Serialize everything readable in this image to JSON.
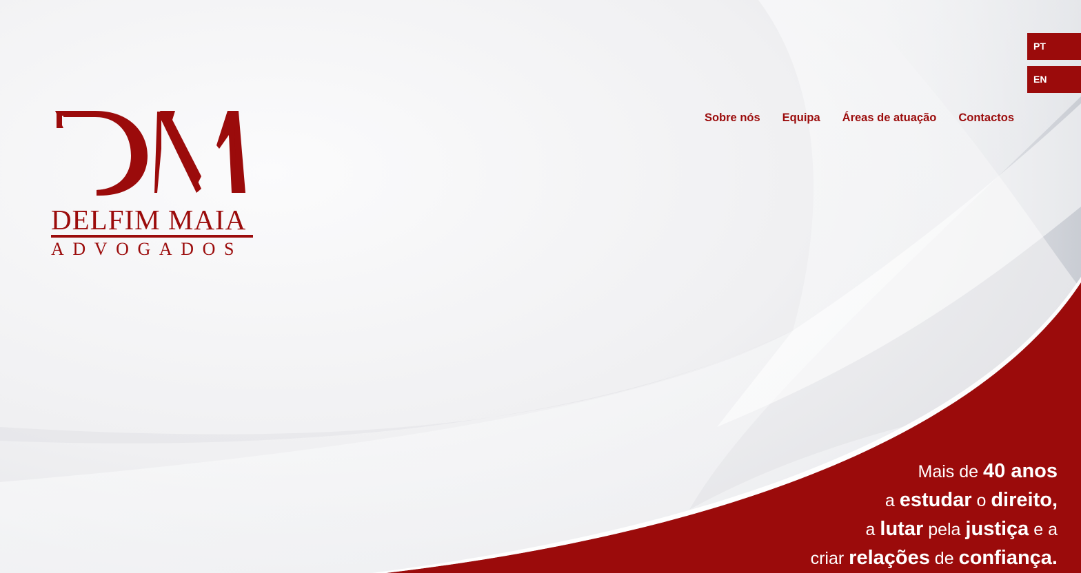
{
  "brand": {
    "name": "DELFIM MAIA",
    "subtitle": "ADVOGADOS",
    "monogram": "DM",
    "color": "#9b0b0b"
  },
  "languages": [
    {
      "label": "PT"
    },
    {
      "label": "EN"
    }
  ],
  "nav": {
    "items": [
      {
        "label": "Sobre nós"
      },
      {
        "label": "Equipa"
      },
      {
        "label": "Áreas de atuação"
      },
      {
        "label": "Contactos"
      }
    ]
  },
  "tagline": {
    "line1": {
      "t1": "Mais de ",
      "b1": "40 anos"
    },
    "line2": {
      "t1": "a ",
      "b1": "estudar",
      "t2": " o ",
      "b2": "direito,"
    },
    "line3": {
      "t1": "a ",
      "b1": "lutar",
      "t2": " pela ",
      "b2": "justiça",
      "t3": " e a"
    },
    "line4": {
      "t1": "criar ",
      "b1": "relações",
      "t2": " de ",
      "b2": "confiança."
    }
  },
  "colors": {
    "accent": "#9b0b0b",
    "background": "#ececee",
    "text_on_accent": "#ffffff"
  }
}
